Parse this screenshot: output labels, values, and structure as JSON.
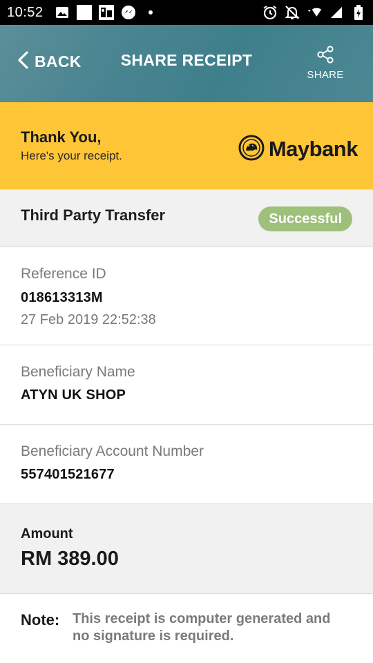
{
  "status_bar": {
    "time": "10:52",
    "left_icons": [
      "image-icon",
      "white-square-icon",
      "photo-app-icon",
      "messenger-icon",
      "notification-dot-icon"
    ],
    "right_icons": [
      "alarm-icon",
      "mute-icon",
      "wifi-icon",
      "signal-icon",
      "battery-icon"
    ]
  },
  "header": {
    "back_label": "BACK",
    "title": "SHARE RECEIPT",
    "share_label": "SHARE",
    "gradient_color": "#4a8591"
  },
  "banner": {
    "title": "Thank You,",
    "subtitle": "Here's your receipt.",
    "logo_text": "Maybank",
    "background": "#fec536"
  },
  "transaction": {
    "type": "Third Party Transfer",
    "status": "Successful",
    "status_color": "#9dc07a"
  },
  "reference": {
    "label": "Reference ID",
    "value": "018613313M",
    "datetime": "27 Feb 2019 22:52:38"
  },
  "beneficiary_name": {
    "label": "Beneficiary Name",
    "value": "ATYN UK SHOP"
  },
  "beneficiary_account": {
    "label": "Beneficiary Account Number",
    "value": "557401521677"
  },
  "amount": {
    "label": "Amount",
    "value": "RM 389.00"
  },
  "note": {
    "label": "Note:",
    "text": "This receipt is computer generated and no signature is required."
  }
}
